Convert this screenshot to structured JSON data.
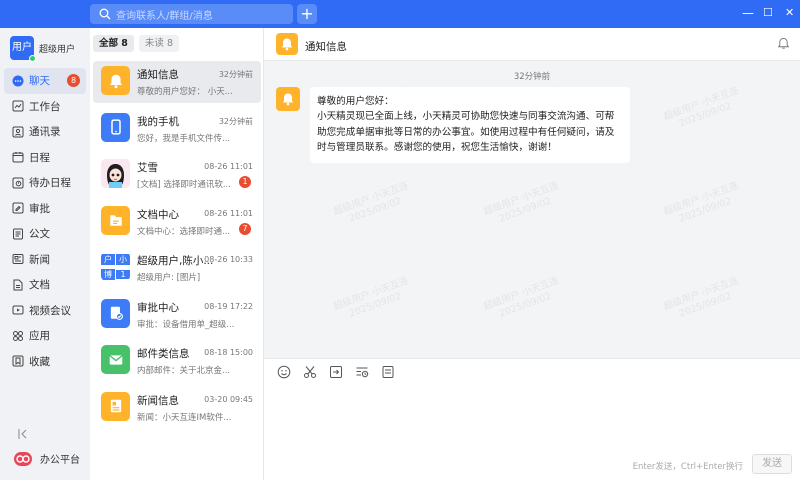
{
  "titlebar": {
    "search_placeholder": "查询联系人/群组/消息",
    "add_label": "+",
    "min_glyph": "—",
    "max_glyph": "☐",
    "close_glyph": "✕"
  },
  "user": {
    "avatar_text": "用户",
    "name": "超级用户"
  },
  "nav": [
    {
      "label": "聊天",
      "icon": "chat-bubble-icon",
      "badge": "8",
      "active": true
    },
    {
      "label": "工作台",
      "icon": "workbench-icon"
    },
    {
      "label": "通讯录",
      "icon": "contacts-icon"
    },
    {
      "label": "日程",
      "icon": "calendar-icon"
    },
    {
      "label": "待办日程",
      "icon": "todo-icon"
    },
    {
      "label": "审批",
      "icon": "approval-icon"
    },
    {
      "label": "公文",
      "icon": "official-document-icon"
    },
    {
      "label": "新闻",
      "icon": "news-icon"
    },
    {
      "label": "文档",
      "icon": "document-icon"
    },
    {
      "label": "视频会议",
      "icon": "video-meeting-icon"
    },
    {
      "label": "应用",
      "icon": "apps-icon"
    },
    {
      "label": "收藏",
      "icon": "favorites-icon"
    }
  ],
  "sidebar_footer": {
    "collapse_glyph": "⊲|",
    "office_label": "办公平台"
  },
  "tabs": [
    {
      "label": "全部 8",
      "active": true
    },
    {
      "label": "未读 8",
      "active": false
    }
  ],
  "conversations": [
    {
      "title": "通知信息",
      "time": "32分钟前",
      "preview": "尊敬的用户您好：  小天...",
      "avatar_color": "#ffb32a",
      "icon": "bell-icon",
      "badge": ""
    },
    {
      "title": "我的手机",
      "time": "32分钟前",
      "preview": "您好，我是手机文件传...",
      "avatar_color": "#3e7cf7",
      "icon": "phone-icon",
      "badge": ""
    },
    {
      "title": "艾雪",
      "time": "08-26 11:01",
      "preview": "[文档] 选择即时通讯软...",
      "avatar_color": "#f4d9e4",
      "icon": "person-avatar-icon",
      "badge": "1"
    },
    {
      "title": "文档中心",
      "time": "08-26 11:01",
      "preview": "文档中心：选择即时通...",
      "avatar_color": "#ffb32a",
      "icon": "folder-icon",
      "badge": "7"
    },
    {
      "title": "超级用户,陈小...",
      "time": "08-26 10:33",
      "preview": "超级用户: [图片]",
      "avatar_color": "#3e7cf7",
      "icon": "group-avatar-icon",
      "badge": "",
      "group_chars": [
        "户",
        "小",
        "博",
        "1"
      ]
    },
    {
      "title": "审批中心",
      "time": "08-19 17:22",
      "preview": "审批：设备借用单_超级...",
      "avatar_color": "#3e7cf7",
      "icon": "approval-doc-icon",
      "badge": ""
    },
    {
      "title": "邮件类信息",
      "time": "08-18 15:00",
      "preview": "内部邮件：关于北京金...",
      "avatar_color": "#47c26b",
      "icon": "mail-icon",
      "badge": ""
    },
    {
      "title": "新闻信息",
      "time": "03-20 09:45",
      "preview": "新闻：小天互连IM软件...",
      "avatar_color": "#ffb32a",
      "icon": "newspaper-icon",
      "badge": ""
    }
  ],
  "chat": {
    "title": "通知信息",
    "message_time": "32分钟前",
    "message_lines": [
      "尊敬的用户您好：",
      "小天精灵现已全面上线，小天精灵可协助您快速与同事交流沟通、可帮",
      "助您完成单据审批等日常的办公事宜。如使用过程中有任何疑问，请及",
      "时与管理员联系。感谢您的使用，祝您生活愉快，谢谢！"
    ],
    "watermark_name": "超级用户 小天互连",
    "watermark_date": "2025/09/02"
  },
  "compose": {
    "tools": [
      "emoji-icon",
      "scissors-icon",
      "file-send-icon",
      "history-icon",
      "template-icon"
    ],
    "hint": "Enter发送，Ctrl+Enter换行",
    "send_label": "发送"
  }
}
